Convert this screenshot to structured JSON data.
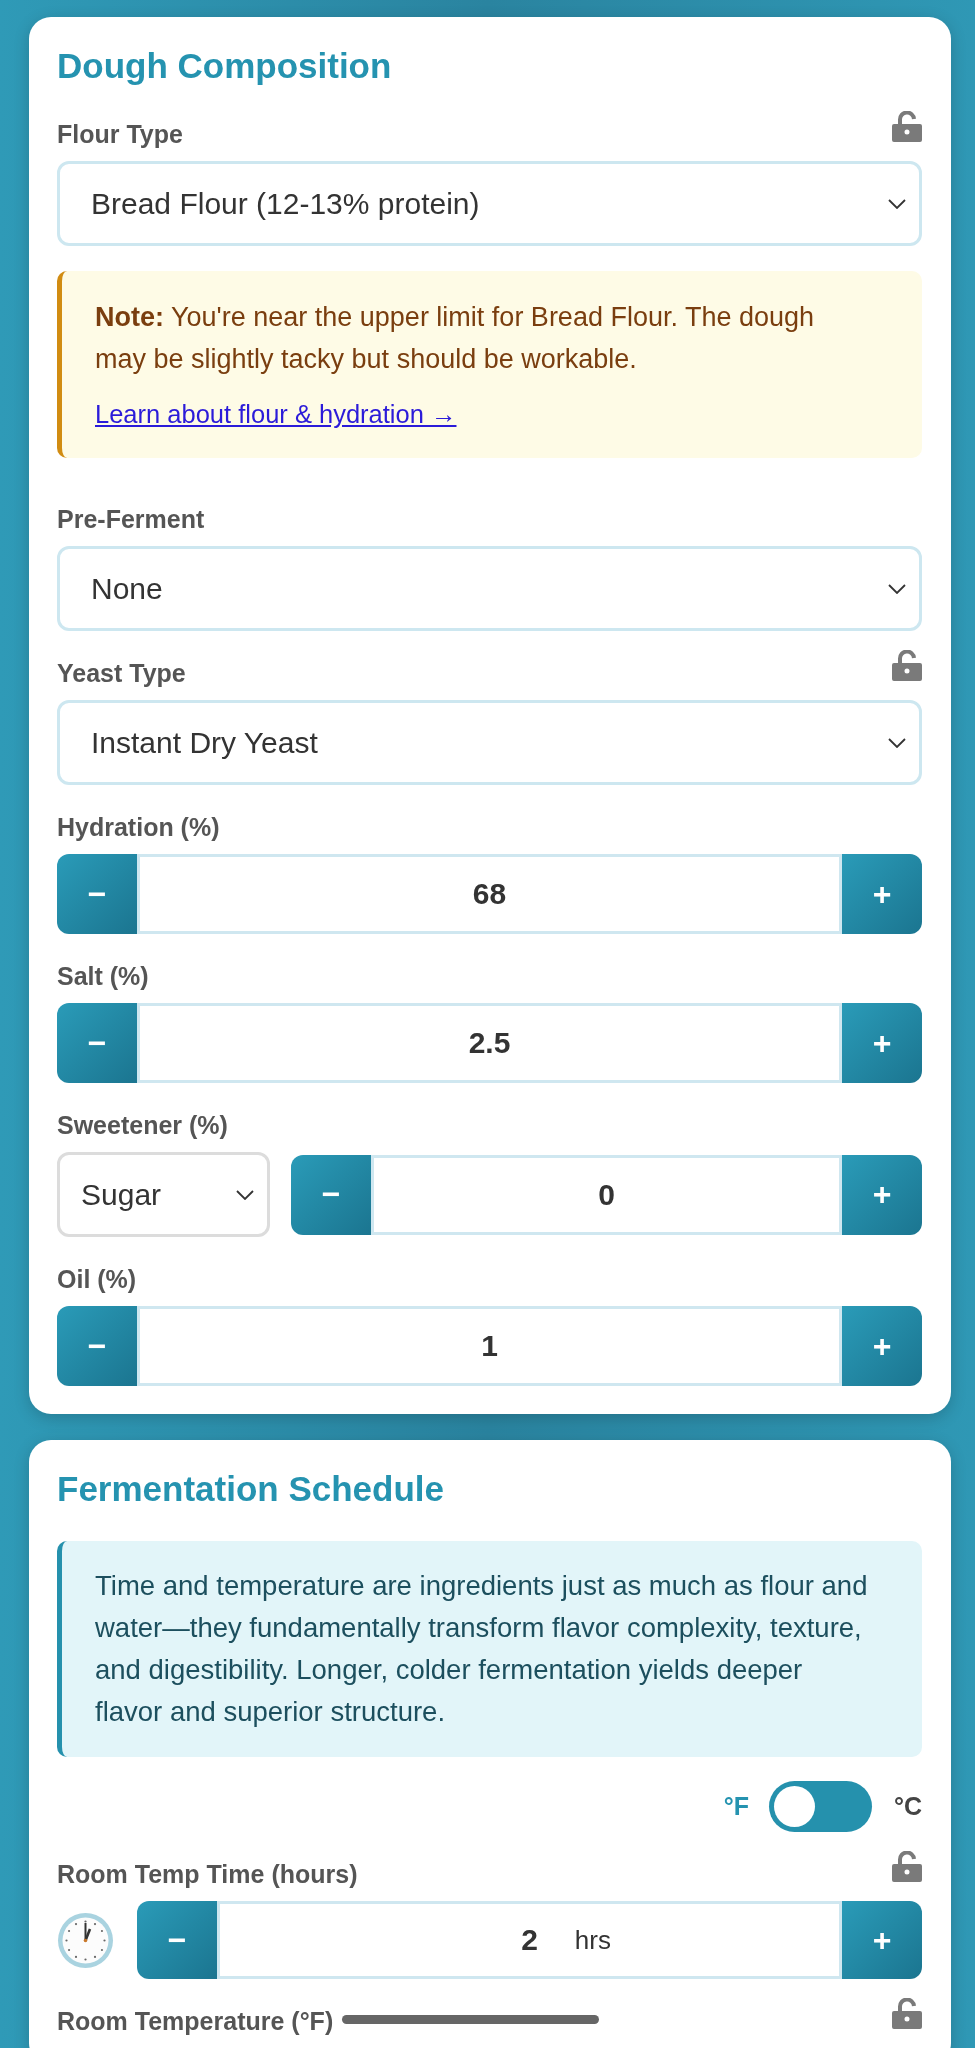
{
  "sections": [
    {
      "title": "Dough Composition",
      "items": [
        {
          "kind": "select",
          "label": "Flour Type",
          "locked": false,
          "value": "Bread Flour (12-13% protein)"
        },
        {
          "kind": "note",
          "text": "**Note:** You're near the upper limit for Bread Flour. The dough may be slightly tacky but should be workable.",
          "link": "Learn about flour & hydration →"
        },
        {
          "kind": "select",
          "label": "Pre-Ferment",
          "value": "None"
        },
        {
          "kind": "select",
          "label": "Yeast Type",
          "locked": false,
          "value": "Instant Dry Yeast"
        },
        {
          "kind": "stepper",
          "label": "Hydration (%)",
          "value": "68",
          "decrement": "−",
          "increment": "+"
        },
        {
          "kind": "stepper",
          "label": "Salt (%)",
          "value": "2.5",
          "decrement": "−",
          "increment": "+"
        },
        {
          "kind": "sweetener",
          "label": "Sweetener (%)",
          "sweetener": "Sugar",
          "value": "0",
          "decrement": "−",
          "increment": "+"
        },
        {
          "kind": "stepper",
          "label": "Oil (%)",
          "value": "1",
          "decrement": "−",
          "increment": "+"
        }
      ]
    },
    {
      "title": "Fermentation Schedule",
      "items": [
        {
          "kind": "info",
          "text": "Time and temperature are ingredients just as much as flour and water—they fundamentally transform flavor complexity, texture, and digestibility. Longer, colder fermentation yields deeper flavor and superior structure."
        },
        {
          "kind": "unit_toggle",
          "options": [
            {
              "label": "°F",
              "selected": true
            },
            {
              "label": "°C",
              "selected": false
            }
          ]
        },
        {
          "kind": "timed_stepper",
          "label": "Room Temp Time (hours)",
          "locked": false,
          "value": "2",
          "unit": "hrs",
          "decrement": "−",
          "increment": "+"
        },
        {
          "kind": "slider",
          "label": "Room Temperature (°F)",
          "locked": false
        }
      ]
    }
  ]
}
